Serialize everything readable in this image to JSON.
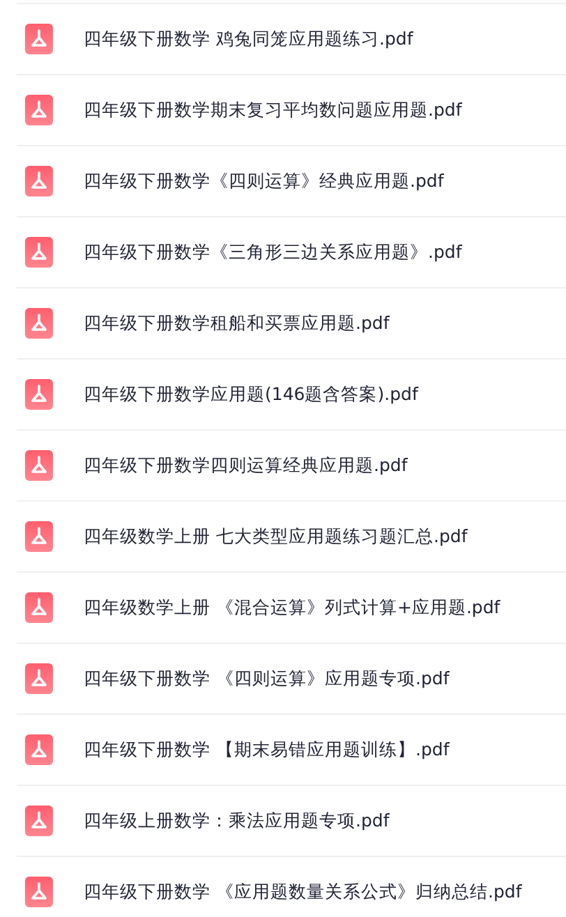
{
  "files": [
    {
      "name": "四年级下册数学 鸡兔同笼应用题练习.pdf"
    },
    {
      "name": "四年级下册数学期末复习平均数问题应用题.pdf"
    },
    {
      "name": "四年级下册数学《四则运算》经典应用题.pdf"
    },
    {
      "name": "四年级下册数学《三角形三边关系应用题》.pdf"
    },
    {
      "name": "四年级下册数学租船和买票应用题.pdf"
    },
    {
      "name": "四年级下册数学应用题(146题含答案).pdf"
    },
    {
      "name": "四年级下册数学四则运算经典应用题.pdf"
    },
    {
      "name": "四年级数学上册 七大类型应用题练习题汇总.pdf"
    },
    {
      "name": "四年级数学上册 《混合运算》列式计算+应用题.pdf"
    },
    {
      "name": "四年级下册数学 《四则运算》应用题专项.pdf"
    },
    {
      "name": "四年级下册数学 【期末易错应用题训练】.pdf"
    },
    {
      "name": "四年级上册数学：乘法应用题专项.pdf"
    },
    {
      "name": "四年级下册数学 《应用题数量关系公式》归纳总结.pdf"
    }
  ]
}
